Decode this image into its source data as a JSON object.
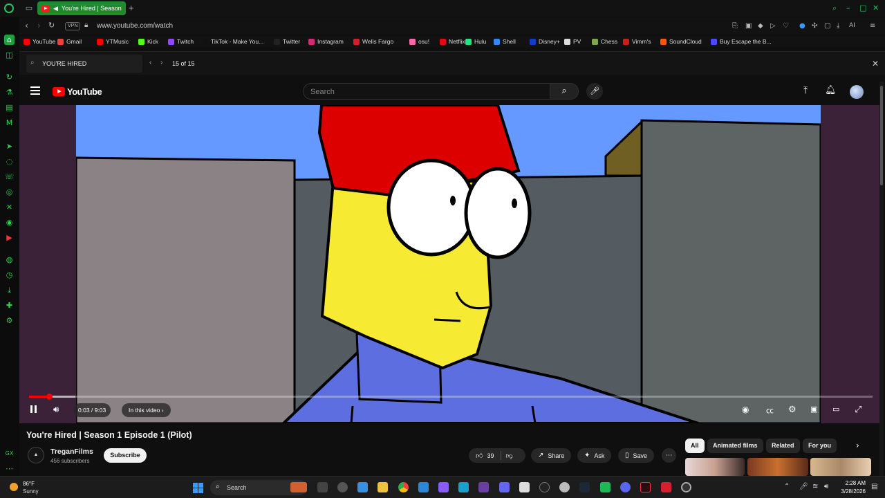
{
  "browser": {
    "active_tab_title": "You're Hired | Season",
    "url": "www.youtube.com/watch",
    "vpn_label": "VPN",
    "ai_label": "AI",
    "bookmarks": [
      {
        "label": "YouTube",
        "color": "#ff0000"
      },
      {
        "label": "Gmail",
        "color": "#ea4335"
      },
      {
        "label": "YTMusic",
        "color": "#ff0000"
      },
      {
        "label": "Kick",
        "color": "#53fc18"
      },
      {
        "label": "Twitch",
        "color": "#9146ff"
      },
      {
        "label": "TikTok - Make You...",
        "color": "#111111"
      },
      {
        "label": "Twitter",
        "color": "#222222"
      },
      {
        "label": "Instagram",
        "color": "#d62976"
      },
      {
        "label": "Wells Fargo",
        "color": "#d71e28"
      },
      {
        "label": "osu!",
        "color": "#ff66aa"
      },
      {
        "label": "Netflix",
        "color": "#e50914"
      },
      {
        "label": "Hulu",
        "color": "#1ce783"
      },
      {
        "label": "Shell",
        "color": "#3b82f6"
      },
      {
        "label": "Disney+",
        "color": "#113ccf"
      },
      {
        "label": "PV",
        "color": "#dddddd"
      },
      {
        "label": "Chess",
        "color": "#7fa650"
      },
      {
        "label": "Vimm's",
        "color": "#c81e1e"
      },
      {
        "label": "SoundCloud",
        "color": "#ff5500"
      },
      {
        "label": "Buy Escape the B...",
        "color": "#4a4aff"
      }
    ]
  },
  "find_bar": {
    "query": "YOU'RE HIRED",
    "count": "15 of 15"
  },
  "youtube": {
    "logo_text": "YouTube",
    "search_placeholder": "Search",
    "player": {
      "time": "0:03 / 9:03",
      "chapter_label": "In this video",
      "progress_fraction": 0.006,
      "loaded_fraction": 0.03
    },
    "video": {
      "title": "You're Hired | Season 1 Episode 1 (Pilot)",
      "channel_name": "TreganFilms",
      "subscribers": "456 subscribers",
      "subscribe_label": "Subscribe",
      "likes": "39",
      "share_label": "Share",
      "ask_label": "Ask",
      "save_label": "Save"
    },
    "chips": [
      "All",
      "Animated films",
      "Related",
      "For you"
    ]
  },
  "taskbar": {
    "temperature": "86°F",
    "weather": "Sunny",
    "search_label": "Search",
    "time": "2:28 AM",
    "date": "3/28/2026"
  },
  "colors": {
    "accent": "#22c55e",
    "youtube_red": "#ff0000",
    "sky": "#6699ff",
    "hair": "#dd0000",
    "skin": "#f7ea33",
    "shirt": "#5d6fe0"
  }
}
